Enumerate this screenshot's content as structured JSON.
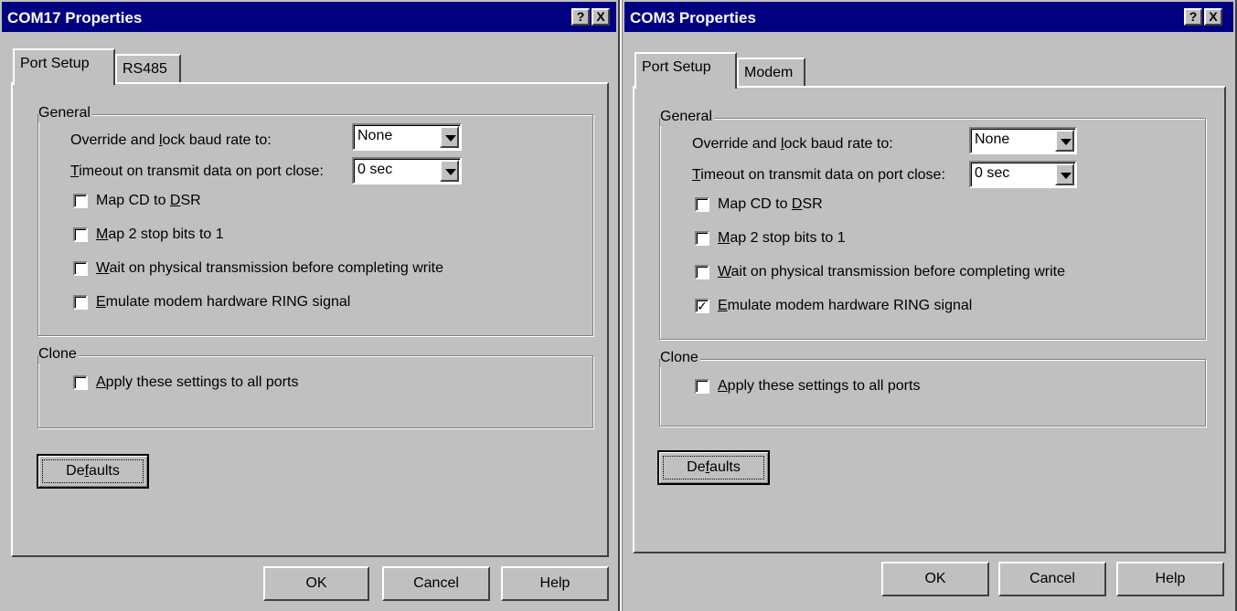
{
  "dialogs": [
    {
      "title": "COM17 Properties",
      "title_buttons": [
        "?",
        "X"
      ],
      "tabs": [
        {
          "label": "Port Setup",
          "active": true
        },
        {
          "label": "RS485",
          "active": false
        }
      ],
      "general": {
        "legend": "General",
        "baud": {
          "pre": "Override and ",
          "key": "l",
          "post": "ock baud rate to:",
          "value": "None"
        },
        "timeout": {
          "pre": "",
          "key": "T",
          "post": "imeout on transmit data on port close:",
          "value": "0 sec"
        },
        "checkboxes": [
          {
            "pre": "Map CD to ",
            "key": "D",
            "post": "SR",
            "checked": false
          },
          {
            "pre": "",
            "key": "M",
            "post": "ap 2 stop bits to 1",
            "checked": false
          },
          {
            "pre": "",
            "key": "W",
            "post": "ait on physical transmission before completing write",
            "checked": false
          },
          {
            "pre": "",
            "key": "E",
            "post": "mulate modem hardware RING signal",
            "checked": false
          }
        ]
      },
      "clone": {
        "legend": "Clone",
        "checkbox": {
          "pre": "",
          "key": "A",
          "post": "pply these settings to all ports",
          "checked": false
        }
      },
      "defaults_button": {
        "pre": "De",
        "key": "f",
        "post": "aults"
      },
      "footer_buttons": [
        "OK",
        "Cancel",
        "Help"
      ]
    },
    {
      "title": "COM3 Properties",
      "title_buttons": [
        "?",
        "X"
      ],
      "tabs": [
        {
          "label": "Port Setup",
          "active": true
        },
        {
          "label": "Modem",
          "active": false
        }
      ],
      "general": {
        "legend": "General",
        "baud": {
          "pre": "Override and ",
          "key": "l",
          "post": "ock baud rate to:",
          "value": "None"
        },
        "timeout": {
          "pre": "",
          "key": "T",
          "post": "imeout on transmit data on port close:",
          "value": "0 sec"
        },
        "checkboxes": [
          {
            "pre": "Map CD to ",
            "key": "D",
            "post": "SR",
            "checked": false
          },
          {
            "pre": "",
            "key": "M",
            "post": "ap 2 stop bits to 1",
            "checked": false
          },
          {
            "pre": "",
            "key": "W",
            "post": "ait on physical transmission before completing write",
            "checked": false
          },
          {
            "pre": "",
            "key": "E",
            "post": "mulate modem hardware RING signal",
            "checked": true
          }
        ]
      },
      "clone": {
        "legend": "Clone",
        "checkbox": {
          "pre": "",
          "key": "A",
          "post": "pply these settings to all ports",
          "checked": false
        }
      },
      "defaults_button": {
        "pre": "De",
        "key": "f",
        "post": "aults"
      },
      "footer_buttons": [
        "OK",
        "Cancel",
        "Help"
      ]
    }
  ],
  "colors": {
    "titlebar": "#000080",
    "face": "#c0c0c0",
    "check_mark": "#000000"
  }
}
